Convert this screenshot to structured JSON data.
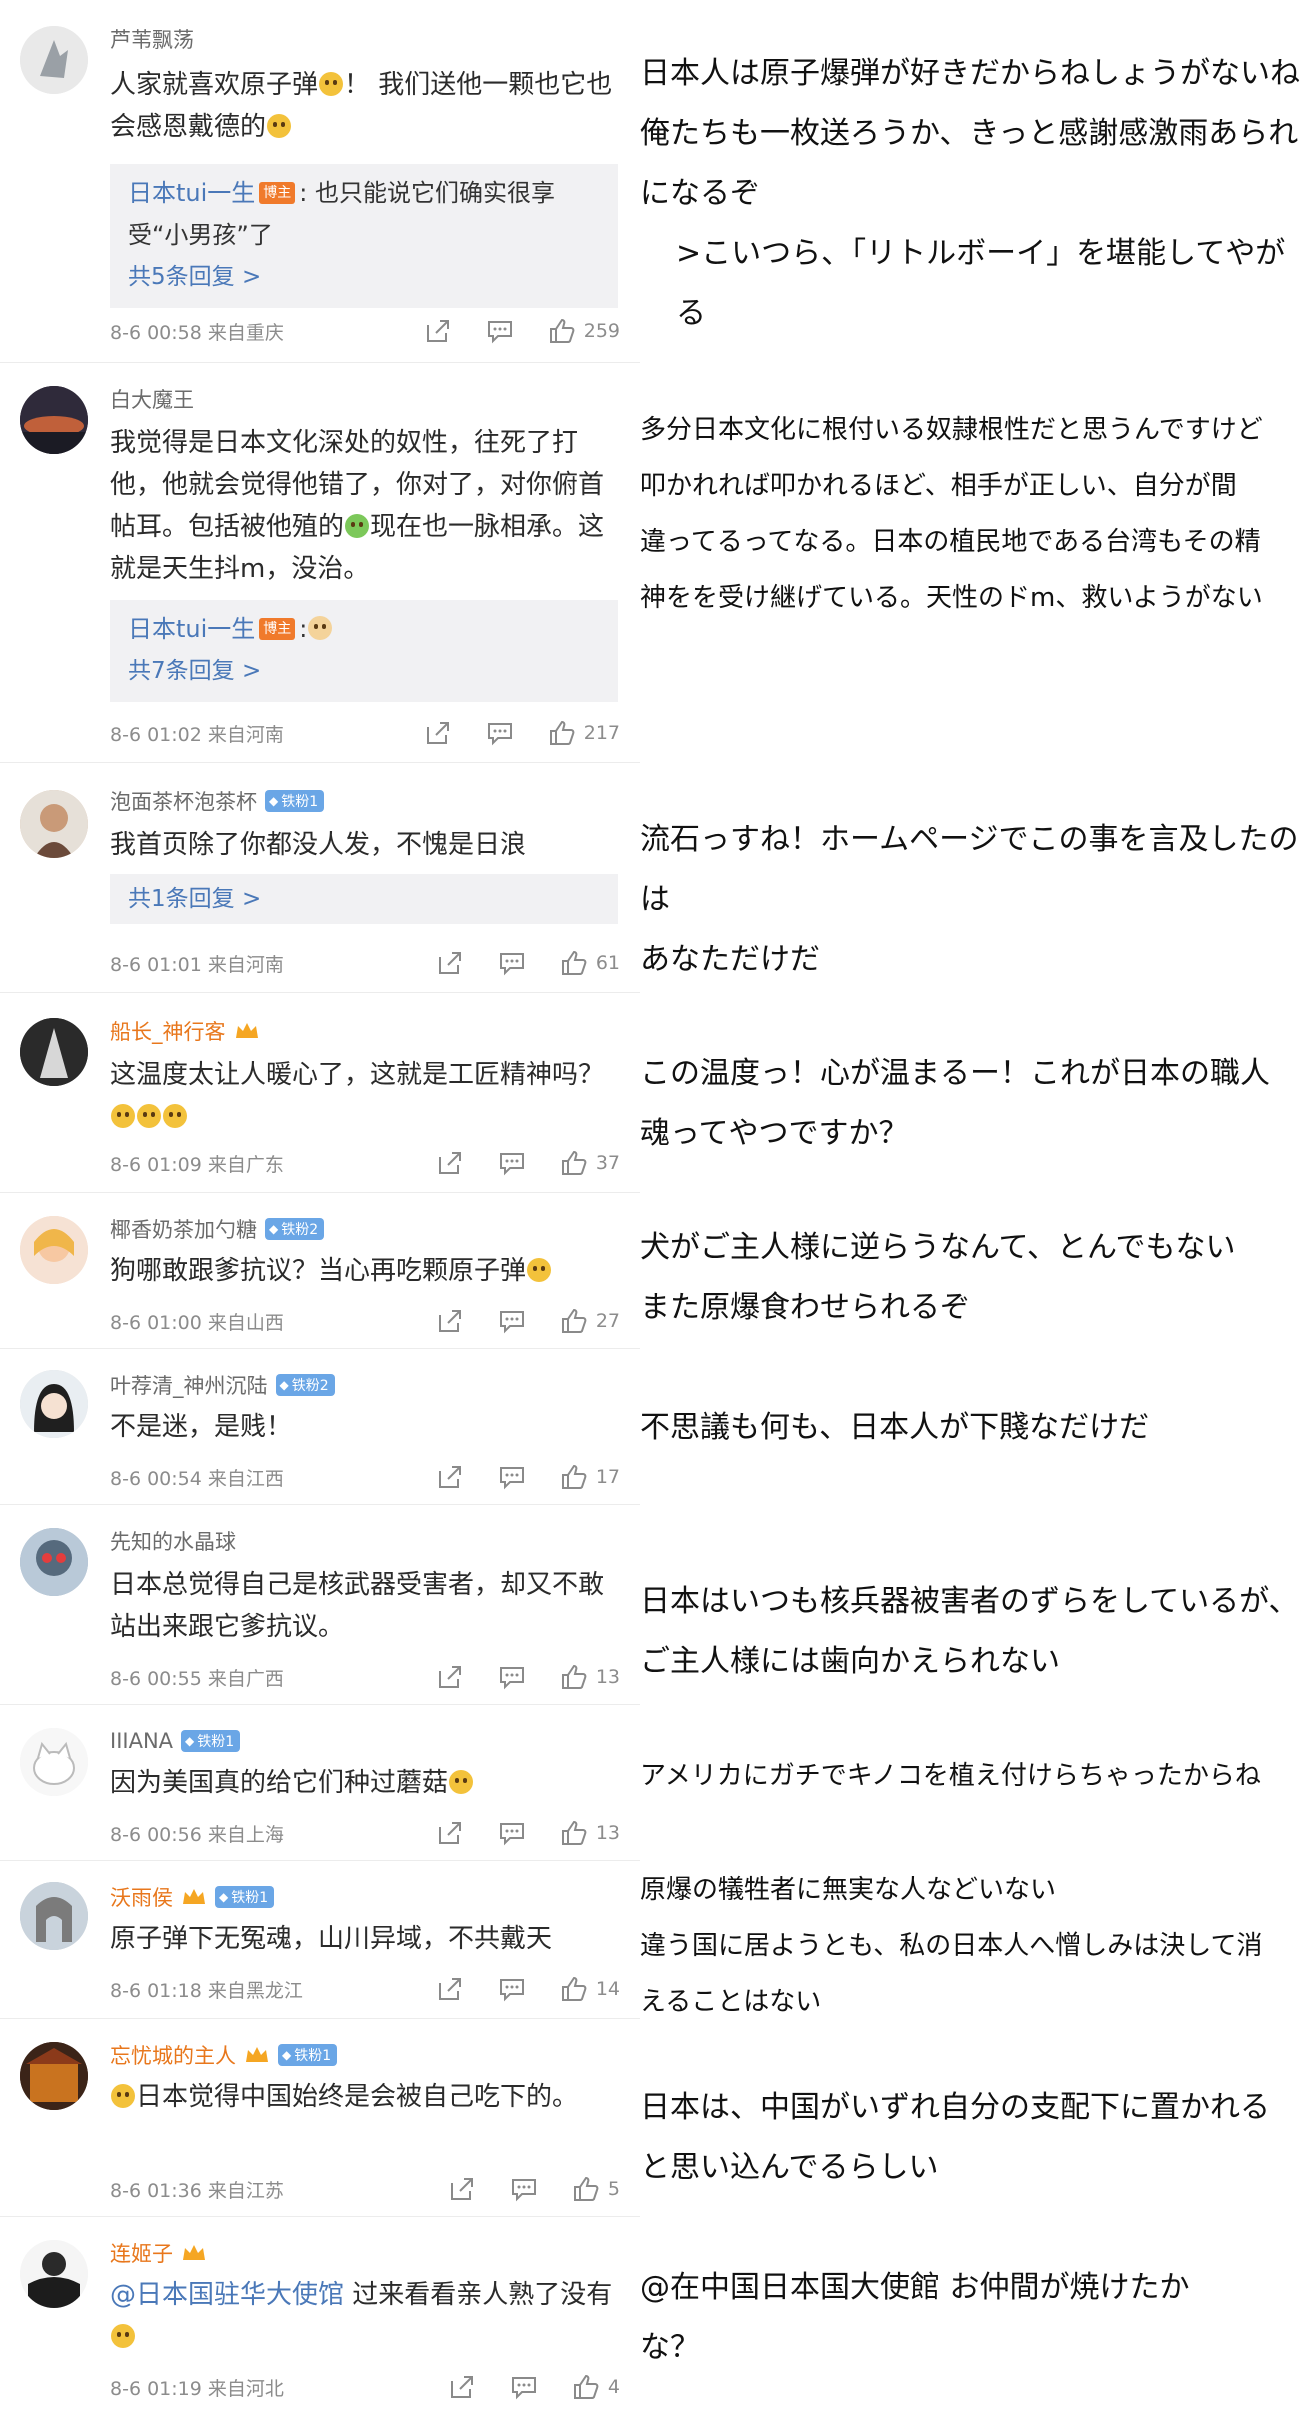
{
  "comments": [
    {
      "username": "芦苇飘荡",
      "text": "人家就喜欢原子弹",
      "text_after": "！ 我们送他一颗也它也会感恩戴德的",
      "reply": {
        "author": "日本tui一生",
        "author_badge": "博主",
        "text": ": 也只能说它们确实很享受“小男孩”了",
        "more": "共5条回复 >"
      },
      "time": "8-6 00:58 来自重庆",
      "likes": "259"
    },
    {
      "username": "白大魔王",
      "text": "我觉得是日本文化深处的奴性，往死了打他，他就会觉得他错了，你对了，对你俯首帖耳。包括被他殖的",
      "text_after": "现在也一脉相承。这就是天生抖m，没治。",
      "reply": {
        "author": "日本tui一生",
        "author_badge": "博主",
        "text": ":",
        "more": "共7条回复 >"
      },
      "time": "8-6 01:02 来自河南",
      "likes": "217"
    },
    {
      "username": "泡面茶杯泡茶杯",
      "fan_badge": "铁粉1",
      "text": "我首页除了你都没人发，不愧是日浪",
      "reply": {
        "more": "共1条回复 >"
      },
      "time": "8-6 01:01 来自河南",
      "likes": "61"
    },
    {
      "username": "船长_神行客",
      "text": "这温度太让人暖心了，这就是工匠精神吗？",
      "time": "8-6 01:09 来自广东",
      "likes": "37"
    },
    {
      "username": "椰香奶茶加勺糖",
      "fan_badge": "铁粉2",
      "text": "狗哪敢跟爹抗议？当心再吃颗原子弹",
      "time": "8-6 01:00 来自山西",
      "likes": "27"
    },
    {
      "username": "叶荐清_神州沉陆",
      "fan_badge": "铁粉2",
      "text": "不是迷，是贱！",
      "time": "8-6 00:54 来自江西",
      "likes": "17"
    },
    {
      "username": "先知的水晶球",
      "text": "日本总觉得自己是核武器受害者，却又不敢站出来跟它爹抗议。",
      "time": "8-6 00:55 来自广西",
      "likes": "13"
    },
    {
      "username": "IIIANA",
      "fan_badge": "铁粉1",
      "text": "因为美国真的给它们种过蘑菇",
      "time": "8-6 00:56 来自上海",
      "likes": "13"
    },
    {
      "username": "沃雨侯",
      "fan_badge": "铁粉1",
      "text": "原子弹下无冤魂，山川异域，不共戴天",
      "time": "8-6 01:18 来自黑龙江",
      "likes": "14"
    },
    {
      "username": "忘忧城的主人",
      "fan_badge": "铁粉1",
      "text": "日本觉得中国始终是会被自己吃下的。",
      "time": "8-6 01:36 来自江苏",
      "likes": "5"
    },
    {
      "username": "连姬子",
      "mention": "@日本国驻华大使馆",
      "text": " 过来看看亲人熟了没有",
      "time": "8-6 01:19 来自河北",
      "likes": "4"
    }
  ],
  "translations": [
    {
      "lines": [
        "日本人は原子爆弾が好きだからねしょうがないね",
        "俺たちも一枚送ろうか、きっと感謝感激雨あられ",
        "になるぞ"
      ],
      "reply_line": ">こいつら、「リトルボーイ」を堪能してやがる"
    },
    {
      "lines": [
        "多分日本文化に根付いる奴隷根性だと思うんですけど",
        "叩かれれば叩かれるほど、相手が正しい、自分が間",
        "違ってるってなる。日本の植民地である台湾もその精",
        "神をを受け継げている。天性のドm、救いようがない"
      ]
    },
    {
      "lines": [
        "流石っすね！ホームページでこの事を言及したのは",
        "あなただけだ"
      ]
    },
    {
      "lines": [
        "この温度っ！心が温まるー！これが日本の職人",
        "魂ってやつですか？"
      ]
    },
    {
      "lines": [
        "犬がご主人様に逆らうなんて、とんでもない",
        "また原爆食わせられるぞ"
      ]
    },
    {
      "lines": [
        "不思議も何も、日本人が下賤なだけだ"
      ]
    },
    {
      "lines": [
        "日本はいつも核兵器被害者のずらをしているが、",
        "ご主人様には歯向かえられない"
      ]
    },
    {
      "lines": [
        "アメリカにガチでキノコを植え付けらちゃったからね"
      ]
    },
    {
      "lines": [
        "原爆の犠牲者に無実な人などいない",
        "違う国に居ようとも、私の日本人へ憎しみは決して消",
        "えることはない"
      ]
    },
    {
      "lines": [
        "日本は、中国がいずれ自分の支配下に置かれる",
        "と思い込んでるらしい"
      ]
    },
    {
      "lines": [
        "@在中国日本国大使館 お仲間が焼けたか",
        "な？"
      ]
    }
  ],
  "icons": [
    "share-icon",
    "comment-icon",
    "like-icon"
  ],
  "colors": {
    "orange_name": "#e8771c",
    "link_blue": "#4a78b8",
    "reply_bg": "#f1f1f3",
    "fan_badge": "#6aa6e6"
  }
}
